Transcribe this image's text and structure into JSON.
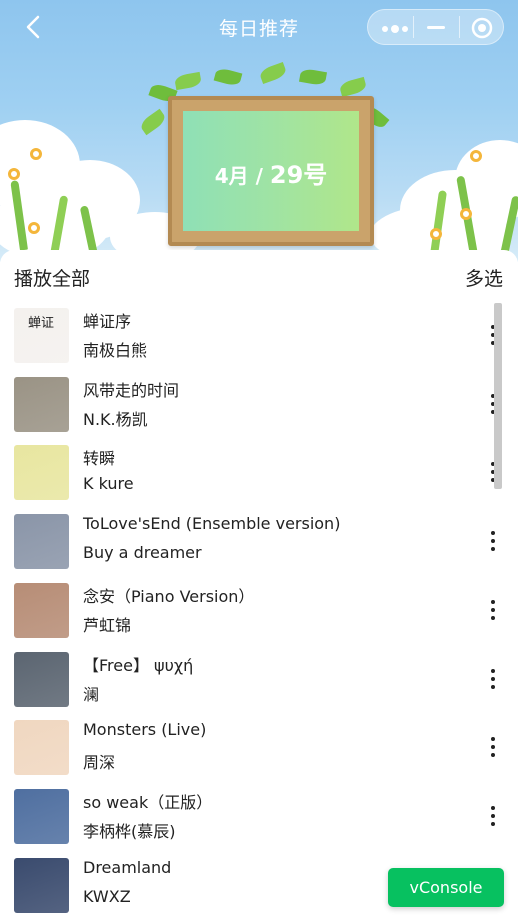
{
  "navbar": {
    "title": "每日推荐",
    "back_icon": "chevron-left-icon",
    "capsule": {
      "more_icon": "more-dots-icon",
      "minimize_icon": "minimize-icon",
      "close_icon": "target-circle-icon"
    }
  },
  "banner": {
    "month": "4月",
    "separator": "/",
    "day": "29号"
  },
  "list_header": {
    "play_all": "播放全部",
    "multi_select": "多选"
  },
  "songs": [
    {
      "name": "蝉证序",
      "artist": "南极白熊",
      "cover_color": "#f4f1ee",
      "cover_text": "蝉证"
    },
    {
      "name": "风带走的时间",
      "artist": "N.K.杨凯",
      "cover_color": "#9a9385"
    },
    {
      "name": "转瞬",
      "artist": "K kure",
      "cover_color": "#e8e6a0"
    },
    {
      "name": "ToLove'sEnd (Ensemble version)",
      "artist": "Buy a dreamer",
      "cover_color": "#8a95a8"
    },
    {
      "name": "念安（Piano Version）",
      "artist": "芦虹锦",
      "cover_color": "#b78d76"
    },
    {
      "name": "【Free】 ψυχή",
      "artist": "澜",
      "cover_color": "#5b6571"
    },
    {
      "name": "Monsters (Live)",
      "artist": "周深",
      "cover_color": "#f0d7c0"
    },
    {
      "name": "so weak（正版）",
      "artist": "李柄桦(慕辰)",
      "cover_color": "#4f6fa0"
    },
    {
      "name": "Dreamland",
      "artist": "KWXZ",
      "cover_color": "#3a4b6e"
    }
  ],
  "more_icon": "vertical-dots-icon",
  "vconsole": "vConsole"
}
